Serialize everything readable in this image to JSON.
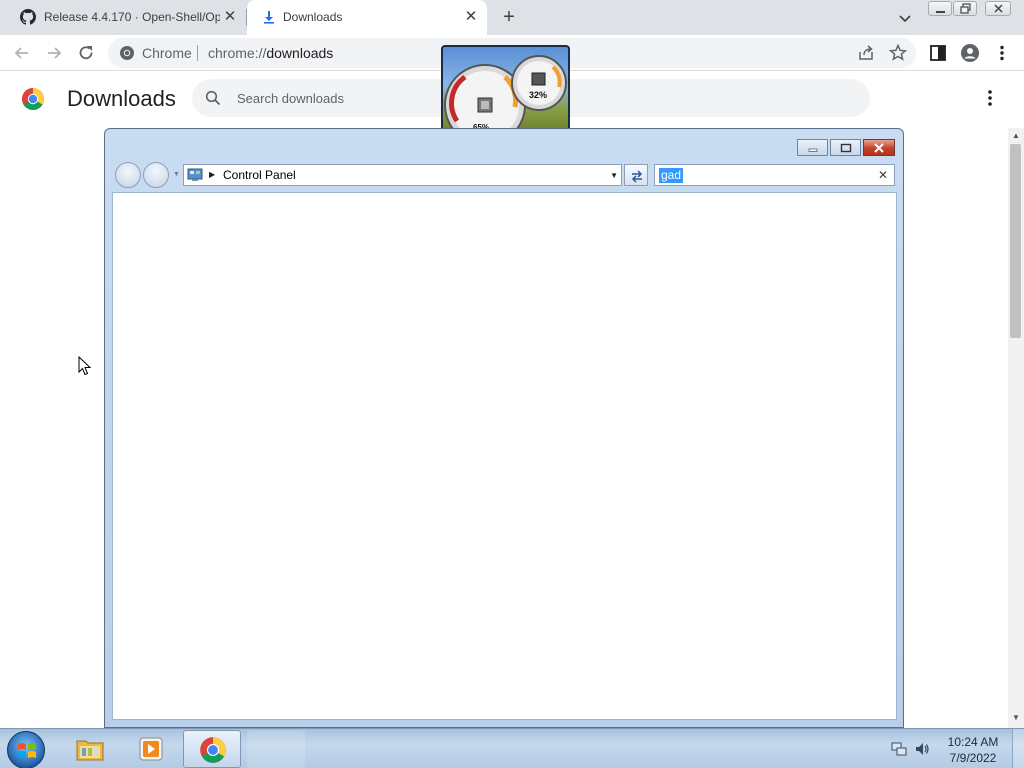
{
  "browser": {
    "tabs": [
      {
        "title": "Release 4.4.170 · Open-Shell/Op",
        "icon": "github-icon",
        "active": false
      },
      {
        "title": "Downloads",
        "icon": "download-icon",
        "active": true
      }
    ],
    "omnibox": {
      "chip": "Chrome",
      "url_scheme": "chrome://",
      "url_host": "downloads"
    }
  },
  "downloads_page": {
    "title": "Downloads",
    "search_placeholder": "Search downloads"
  },
  "control_panel": {
    "address": "Control Panel",
    "search_value": "gad"
  },
  "gadget": {
    "name": "cpu-meter-gadget",
    "memory_value": "32%",
    "cpu_value": "65%"
  },
  "taskbar": {
    "apps": [
      "windows-explorer",
      "media-player",
      "chrome"
    ],
    "clock_time": "10:24 AM",
    "clock_date": "7/9/2022"
  },
  "colors": {
    "chrome_tabstrip": "#dee1e6",
    "selection": "#3399ff",
    "taskbar": "#b3cbe4"
  }
}
